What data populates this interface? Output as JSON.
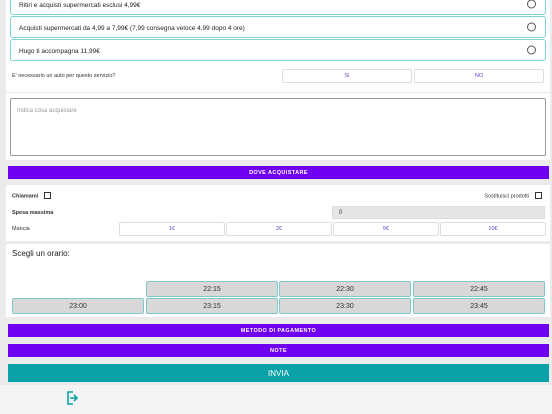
{
  "options": [
    {
      "label": "Ritiri e acquisti supermercati esclusi 4,99€"
    },
    {
      "label": "Acquisti supermercati da 4,99 a 7,99€ (7,99 consegna veloce  4,99 dopo 4 ore)"
    },
    {
      "label": "Hugo ti accompagna 11,99€"
    }
  ],
  "car_question": {
    "label": "E' necessario un auto per questo servizio?",
    "yes": "SI",
    "no": "NO"
  },
  "purchase_textarea": {
    "placeholder": "Indica cosa acquistare"
  },
  "where_button": "DOVE ACQUISTARE",
  "call_me": "Chiamami",
  "substitute": "Sostituisci prodotti",
  "max_spend": {
    "label": "Spesa massima",
    "value": "0"
  },
  "tip": {
    "label": "Mancia",
    "options": [
      "1€",
      "2€",
      "5€",
      "10€"
    ]
  },
  "schedule": {
    "title": "Scegli un orario:",
    "row1": [
      "22:15",
      "22:30",
      "22:45"
    ],
    "row2": [
      "23:00",
      "23:15",
      "23:30",
      "23:45"
    ]
  },
  "payment_button": "METODO DI PAGAMENTO",
  "notes_button": "NOTE",
  "submit_button": "INVIA",
  "colors": {
    "accent": "#7000f0",
    "teal": "#0aa2a6",
    "border": "#7fd4d4"
  }
}
